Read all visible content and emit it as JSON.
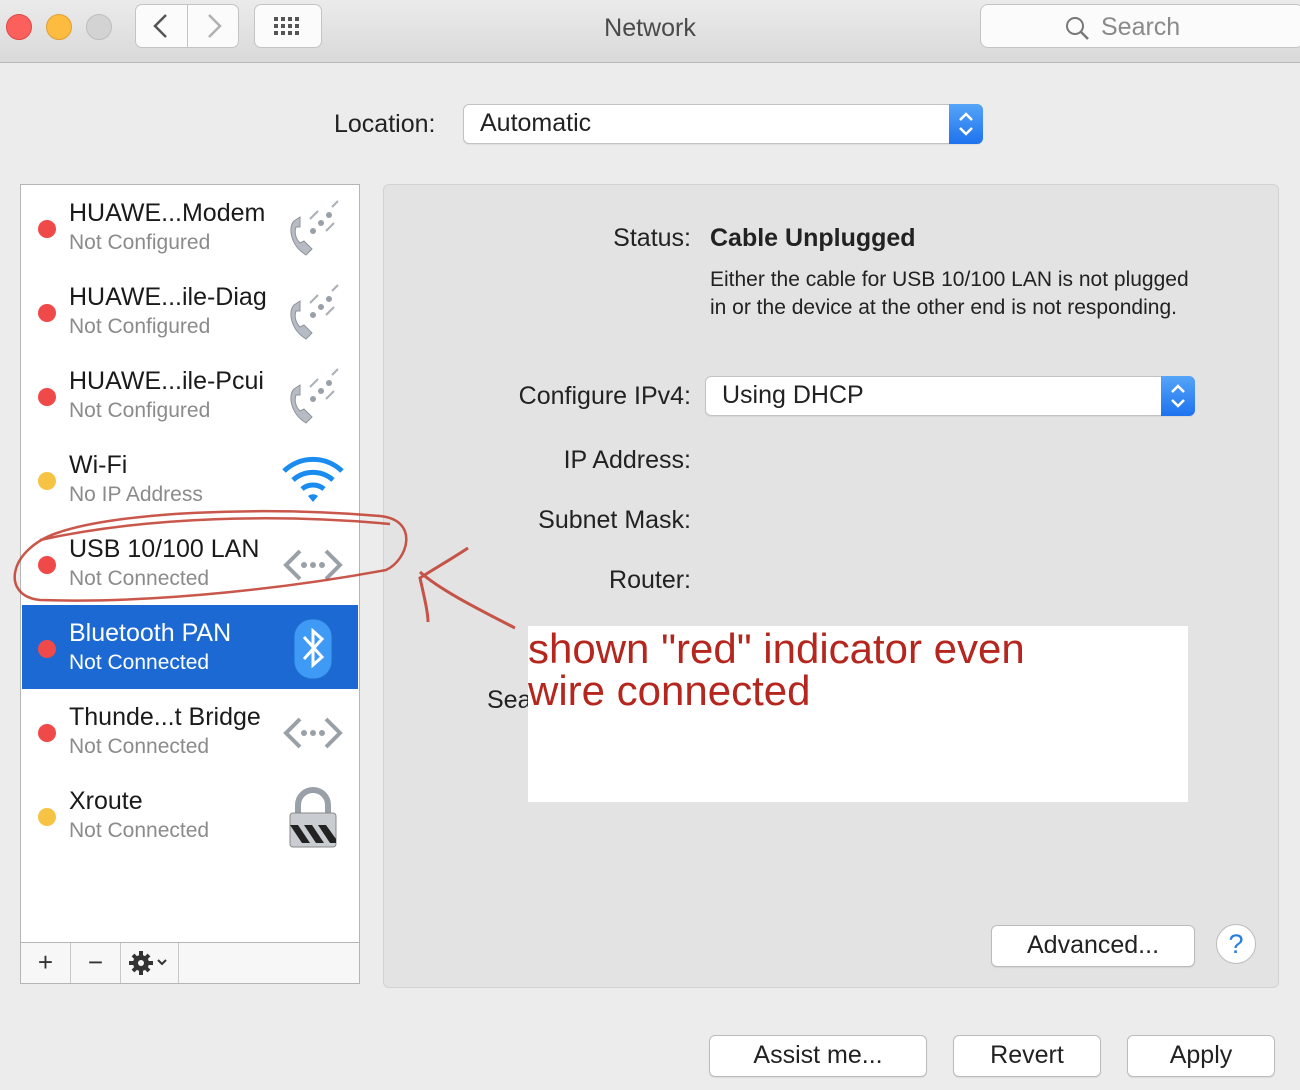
{
  "window": {
    "title": "Network",
    "search_placeholder": "Search",
    "traffic_lights": {
      "close": "#fc605c",
      "minimize": "#fdbc40",
      "zoom": "#cfcfcf"
    }
  },
  "location": {
    "label": "Location:",
    "value": "Automatic"
  },
  "services": [
    {
      "name": "HUAWE...Modem",
      "status": "Not Configured",
      "dot": "#f0494a",
      "icon": "phone-modem-icon",
      "selected": false
    },
    {
      "name": "HUAWE...ile-Diag",
      "status": "Not Configured",
      "dot": "#f0494a",
      "icon": "phone-modem-icon",
      "selected": false
    },
    {
      "name": "HUAWE...ile-Pcui",
      "status": "Not Configured",
      "dot": "#f0494a",
      "icon": "phone-modem-icon",
      "selected": false
    },
    {
      "name": "Wi-Fi",
      "status": "No IP Address",
      "dot": "#f6c345",
      "icon": "wifi-icon",
      "selected": false
    },
    {
      "name": "USB 10/100 LAN",
      "status": "Not Connected",
      "dot": "#f0494a",
      "icon": "ethernet-icon",
      "selected": false
    },
    {
      "name": "Bluetooth PAN",
      "status": "Not Connected",
      "dot": "#f0494a",
      "icon": "bluetooth-icon",
      "selected": true
    },
    {
      "name": "Thunde...t Bridge",
      "status": "Not Connected",
      "dot": "#f0494a",
      "icon": "ethernet-icon",
      "selected": false
    },
    {
      "name": "Xroute",
      "status": "Not Connected",
      "dot": "#f6c345",
      "icon": "vpn-lock-icon",
      "selected": false
    }
  ],
  "sidebar_footer": {
    "add": "+",
    "remove": "−"
  },
  "details": {
    "status_label": "Status:",
    "status_value": "Cable Unplugged",
    "status_description": "Either the cable for USB 10/100 LAN is not plugged in or the device at the other end is not responding.",
    "configure_label": "Configure IPv4:",
    "configure_value": "Using DHCP",
    "ip_label": "IP Address:",
    "subnet_label": "Subnet Mask:",
    "router_label": "Router:",
    "search_domains_label": "Sea"
  },
  "buttons": {
    "advanced": "Advanced...",
    "help": "?",
    "assist": "Assist me...",
    "revert": "Revert",
    "apply": "Apply"
  },
  "annotation": {
    "line1": "shown \"red\" indicator even",
    "line2": "wire connected",
    "color": "#b5261e"
  },
  "accent": "#1c69d4"
}
